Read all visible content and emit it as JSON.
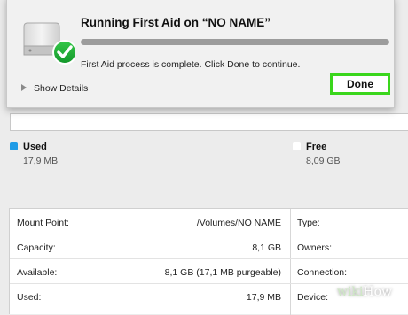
{
  "dialog": {
    "title": "Running First Aid on “NO NAME”",
    "progress_fraction": 1.0,
    "status": "First Aid process is complete. Click Done to continue.",
    "details_label": "Show Details",
    "done_label": "Done",
    "done_highlight_color": "#3ad61c",
    "icon": "external-drive-with-checkmark-icon"
  },
  "usage": {
    "used": {
      "label": "Used",
      "size": "17,9 MB",
      "color": "#1e9be6"
    },
    "free": {
      "label": "Free",
      "size": "8,09 GB",
      "color": "#ffffff"
    }
  },
  "info": {
    "rows": [
      {
        "label": "Mount Point:",
        "value": "/Volumes/NO NAME",
        "label2": "Type:"
      },
      {
        "label": "Capacity:",
        "value": "8,1 GB",
        "label2": "Owners:"
      },
      {
        "label": "Available:",
        "value": "8,1 GB (17,1 MB purgeable)",
        "label2": "Connection:"
      },
      {
        "label": "Used:",
        "value": "17,9 MB",
        "label2": "Device:"
      }
    ]
  },
  "watermark": {
    "prefix": "wiki",
    "suffix": "How"
  }
}
